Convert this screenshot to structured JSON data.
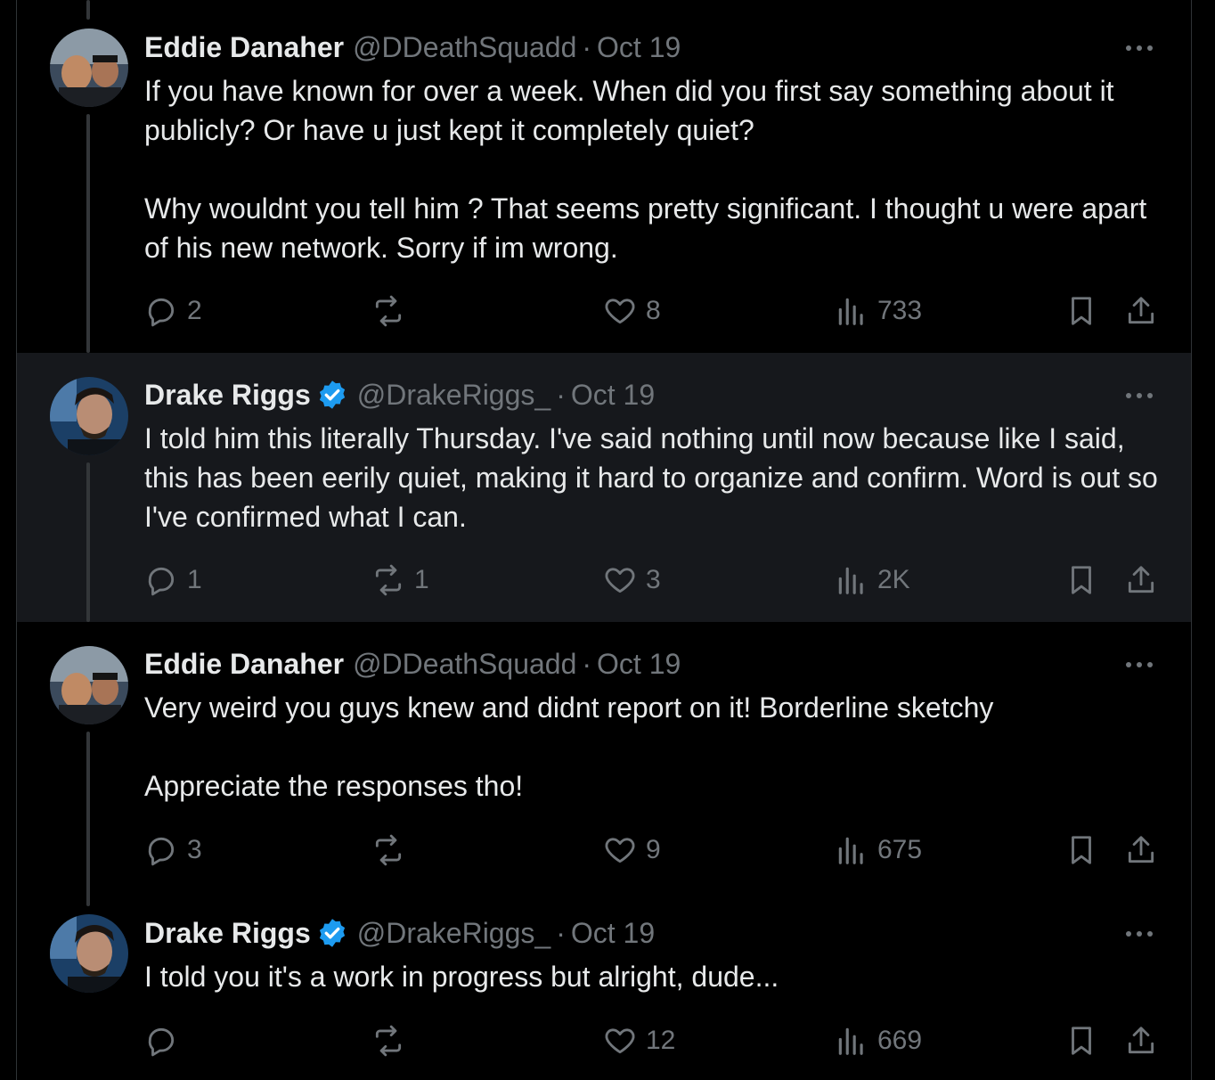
{
  "tweets": [
    {
      "name": "Eddie Danaher",
      "handle": "@DDeathSquadd",
      "sep": "·",
      "date": "Oct 19",
      "verified": false,
      "paragraphs": [
        "If you have known for over a week. When did you first say something about it publicly? Or have u just kept it completely quiet?",
        "Why wouldnt you tell him ? That seems pretty significant. I thought u were apart of his new network. Sorry if im wrong."
      ],
      "replies": "2",
      "reposts": "",
      "likes": "8",
      "views": "733"
    },
    {
      "name": "Drake Riggs",
      "handle": "@DrakeRiggs_",
      "sep": "·",
      "date": "Oct 19",
      "verified": true,
      "paragraphs": [
        "I told him this literally Thursday. I've said nothing until now because like I said, this has been eerily quiet, making it hard to organize and confirm. Word is out so I've confirmed what I can."
      ],
      "replies": "1",
      "reposts": "1",
      "likes": "3",
      "views": "2K"
    },
    {
      "name": "Eddie Danaher",
      "handle": "@DDeathSquadd",
      "sep": "·",
      "date": "Oct 19",
      "verified": false,
      "paragraphs": [
        "Very weird you guys knew and didnt report on it! Borderline sketchy",
        "Appreciate the responses tho!"
      ],
      "replies": "3",
      "reposts": "",
      "likes": "9",
      "views": "675"
    },
    {
      "name": "Drake Riggs",
      "handle": "@DrakeRiggs_",
      "sep": "·",
      "date": "Oct 19",
      "verified": true,
      "paragraphs": [
        "I told you it's a work in progress but alright, dude..."
      ],
      "replies": "",
      "reposts": "",
      "likes": "12",
      "views": "669"
    }
  ],
  "icons": {
    "reply": "reply-icon",
    "repost": "repost-icon",
    "like": "heart-icon",
    "views": "views-icon",
    "bookmark": "bookmark-icon",
    "share": "share-icon",
    "more": "more-icon",
    "verified": "verified-badge-icon"
  },
  "colors": {
    "background": "#000000",
    "highlight": "#16181c",
    "text": "#e7e9ea",
    "muted": "#71767b",
    "verified": "#1d9bf0",
    "thread_line": "#333639"
  }
}
